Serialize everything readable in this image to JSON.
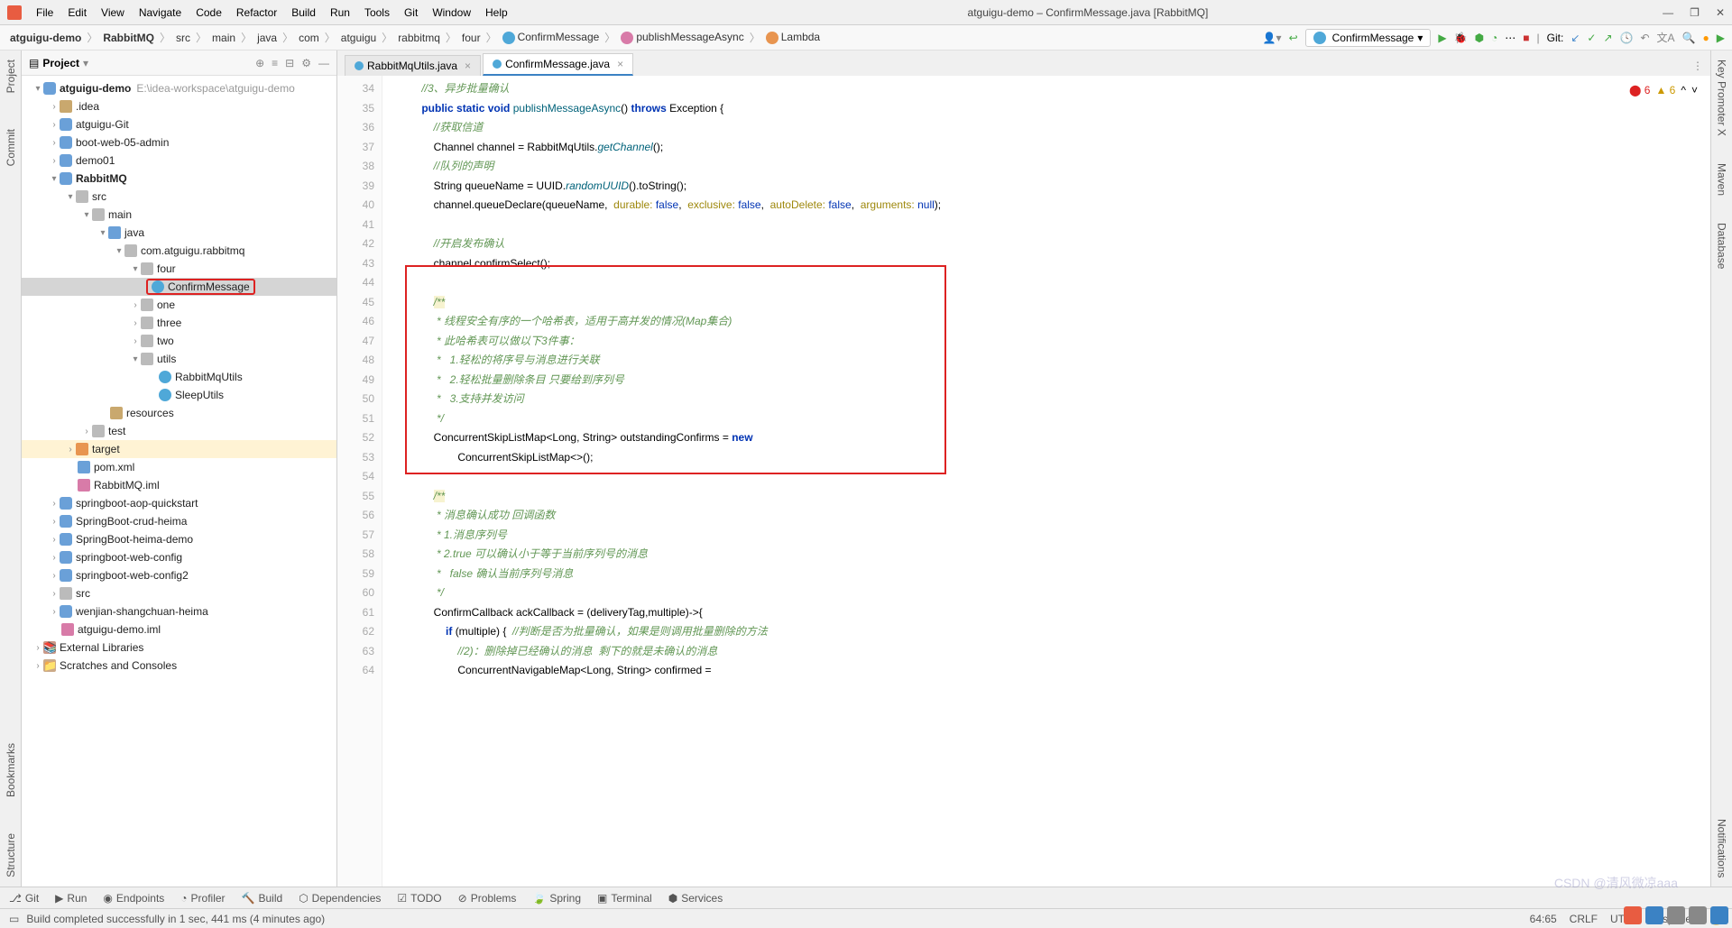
{
  "menu": [
    "File",
    "Edit",
    "View",
    "Navigate",
    "Code",
    "Refactor",
    "Build",
    "Run",
    "Tools",
    "Git",
    "Window",
    "Help"
  ],
  "window_title": "atguigu-demo – ConfirmMessage.java [RabbitMQ]",
  "breadcrumb": {
    "items": [
      "atguigu-demo",
      "RabbitMQ",
      "src",
      "main",
      "java",
      "com",
      "atguigu",
      "rabbitmq",
      "four",
      "ConfirmMessage",
      "publishMessageAsync",
      "Lambda"
    ],
    "run_combo": "ConfirmMessage",
    "git_label": "Git:"
  },
  "project_tool": {
    "title": "Project"
  },
  "tree": {
    "root": {
      "name": "atguigu-demo",
      "path": "E:\\idea-workspace\\atguigu-demo"
    },
    "idea": ".idea",
    "atg_git": "atguigu-Git",
    "boot_admin": "boot-web-05-admin",
    "demo01": "demo01",
    "rabbitmq": "RabbitMQ",
    "src": "src",
    "main": "main",
    "java": "java",
    "pkg": "com.atguigu.rabbitmq",
    "four": "four",
    "confirm": "ConfirmMessage",
    "one": "one",
    "three": "three",
    "two": "two",
    "utils": "utils",
    "rmqutils": "RabbitMqUtils",
    "sleeputils": "SleepUtils",
    "resources": "resources",
    "test": "test",
    "target": "target",
    "pom": "pom.xml",
    "iml": "RabbitMQ.iml",
    "sb_aop": "springboot-aop-quickstart",
    "sb_crud": "SpringBoot-crud-heima",
    "sb_heima": "SpringBoot-heima-demo",
    "sb_webcfg": "springboot-web-config",
    "sb_webcfg2": "springboot-web-config2",
    "src2": "src",
    "wenjian": "wenjian-shangchuan-heima",
    "demo_iml": "atguigu-demo.iml",
    "ext_lib": "External Libraries",
    "scratch": "Scratches and Consoles"
  },
  "tabs": {
    "t1": "RabbitMqUtils.java",
    "t2": "ConfirmMessage.java"
  },
  "inspections": {
    "errors": "6",
    "warnings": "6"
  },
  "gutter": [
    "34",
    "35",
    "36",
    "37",
    "38",
    "39",
    "40",
    "41",
    "42",
    "43",
    "44",
    "45",
    "46",
    "47",
    "48",
    "49",
    "50",
    "51",
    "52",
    "53",
    "54",
    "55",
    "56",
    "57",
    "58",
    "59",
    "60",
    "61",
    "62",
    "63",
    "64"
  ],
  "code": {
    "l34a": "//3、异步批量确认",
    "l35_kw_public": "public ",
    "l35_kw_static": "static ",
    "l35_kw_void": "void ",
    "l35_fn": "publishMessageAsync",
    "l35_rest": "() ",
    "l35_throws": "throws ",
    "l35_ex": "Exception {",
    "l36": "//获取信道",
    "l37a": "Channel channel = RabbitMqUtils.",
    "l37_fn": "getChannel",
    "l37b": "();",
    "l38": "//队列的声明",
    "l39a": "String queueName = UUID.",
    "l39_fn": "randomUUID",
    "l39b": "().toString();",
    "l40a": "channel.queueDeclare(queueName,  ",
    "l40_p1": "durable: ",
    "l40_v1": "false",
    "l40_c1": ",  ",
    "l40_p2": "exclusive: ",
    "l40_v2": "false",
    "l40_c2": ",  ",
    "l40_p3": "autoDelete: ",
    "l40_v3": "false",
    "l40_c3": ",  ",
    "l40_p4": "arguments: ",
    "l40_v4": "null",
    "l40_end": ");",
    "l42": "//开启发布确认",
    "l43": "channel.confirmSelect();",
    "l45": "/**",
    "l46": " * 线程安全有序的一个哈希表，适用于高并发的情况(Map集合)",
    "l47": " * 此哈希表可以做以下3件事：",
    "l48": " *   1.轻松的将序号与消息进行关联",
    "l49": " *   2.轻松批量删除条目 只要给到序列号",
    "l50": " *   3.支持并发访问",
    "l51": " */",
    "l52a": "ConcurrentSkipListMap<Long, String> outstandingConfirms = ",
    "l52_new": "new",
    "l53": "        ConcurrentSkipListMap<>();",
    "l55": "/**",
    "l56": " * 消息确认成功 回调函数",
    "l57": " * 1.消息序列号",
    "l58": " * 2.true 可以确认小于等于当前序列号的消息",
    "l59": " *   false 确认当前序列号消息",
    "l60": " */",
    "l61": "ConfirmCallback ackCallback = (deliveryTag,multiple)->{",
    "l62_if": "if ",
    "l62a": "(multiple) {  ",
    "l62_cmt": "//判断是否为批量确认，如果是则调用批量删除的方法",
    "l63": "//2)：删除掉已经确认的消息  剩下的就是未确认的消息",
    "l64": "ConcurrentNavigableMap<Long, String> confirmed ="
  },
  "left_rail": {
    "project": "Project",
    "commit": "Commit",
    "bookmarks": "Bookmarks",
    "structure": "Structure"
  },
  "right_rail": {
    "keypromoter": "Key Promoter X",
    "maven": "Maven",
    "database": "Database",
    "notifications": "Notifications"
  },
  "bottom": {
    "git": "Git",
    "run": "Run",
    "endpoints": "Endpoints",
    "profiler": "Profiler",
    "build": "Build",
    "dependencies": "Dependencies",
    "todo": "TODO",
    "problems": "Problems",
    "spring": "Spring",
    "terminal": "Terminal",
    "services": "Services"
  },
  "status": {
    "msg": "Build completed successfully in 1 sec, 441 ms (4 minutes ago)",
    "pos": "64:65",
    "sep": "CRLF",
    "enc": "UTF-8",
    "indent": "4 spaces"
  },
  "watermark": "CSDN @清风微凉aaa"
}
